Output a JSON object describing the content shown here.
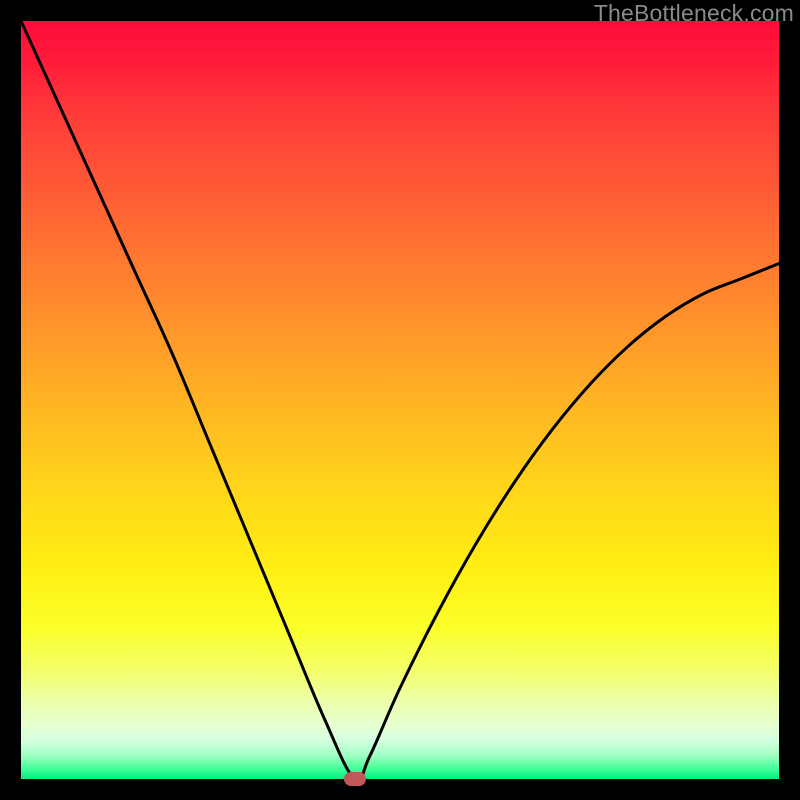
{
  "watermark": "TheBottleneck.com",
  "chart_data": {
    "type": "line",
    "title": "",
    "xlabel": "",
    "ylabel": "",
    "xlim": [
      0,
      1
    ],
    "ylim": [
      0,
      100
    ],
    "grid": false,
    "legend": false,
    "background_gradient": [
      "#ff0b3a",
      "#ffee12",
      "#00ef82"
    ],
    "series": [
      {
        "name": "bottleneck-curve",
        "x": [
          0.0,
          0.05,
          0.1,
          0.15,
          0.2,
          0.25,
          0.3,
          0.35,
          0.4,
          0.44,
          0.46,
          0.5,
          0.55,
          0.6,
          0.65,
          0.7,
          0.75,
          0.8,
          0.85,
          0.9,
          0.95,
          1.0
        ],
        "y": [
          100,
          89,
          78,
          67,
          56,
          44,
          32,
          20,
          8,
          0,
          3,
          12,
          22,
          31,
          39,
          46,
          52,
          57,
          61,
          64,
          66,
          68
        ]
      }
    ],
    "marker": {
      "x": 0.44,
      "y": 0,
      "color": "#c05758"
    },
    "annotations": []
  }
}
